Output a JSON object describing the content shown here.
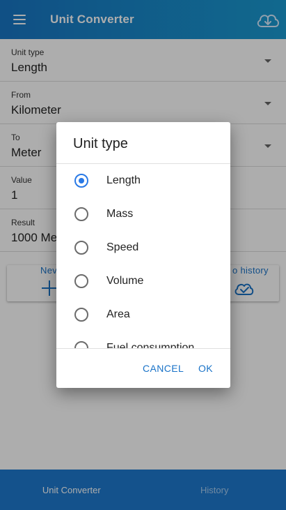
{
  "appbar": {
    "title": "Unit Converter"
  },
  "fields": [
    {
      "label": "Unit type",
      "value": "Length"
    },
    {
      "label": "From",
      "value": "Kilometer"
    },
    {
      "label": "To",
      "value": "Meter"
    },
    {
      "label": "Value",
      "value": "1"
    },
    {
      "label": "Result",
      "value": "1000 Me"
    }
  ],
  "actions": {
    "new_label": "Nev",
    "save_label": "o history"
  },
  "bottom_nav": [
    {
      "label": "Unit Converter",
      "active": true
    },
    {
      "label": "History",
      "active": false
    }
  ],
  "dialog": {
    "title": "Unit type",
    "options": [
      {
        "label": "Length",
        "selected": true
      },
      {
        "label": "Mass",
        "selected": false
      },
      {
        "label": "Speed",
        "selected": false
      },
      {
        "label": "Volume",
        "selected": false
      },
      {
        "label": "Area",
        "selected": false
      },
      {
        "label": "Fuel consumption",
        "selected": false
      }
    ],
    "cancel_label": "CANCEL",
    "ok_label": "OK"
  },
  "icons": {
    "menu": "hamburger-menu-icon",
    "cloud": "cloud-download-icon",
    "add": "plus-icon",
    "saved": "cloud-check-icon",
    "dropdown": "caret-down-icon"
  },
  "colors": {
    "primary": "#1976c4",
    "accent": "#2979e6",
    "nav_bg": "#1e7acf"
  }
}
